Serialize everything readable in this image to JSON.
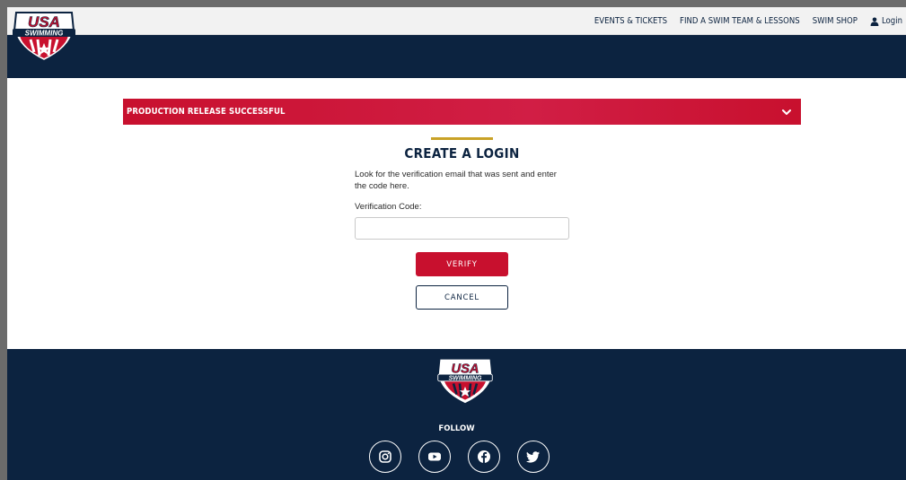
{
  "utility_nav": {
    "items": [
      {
        "label": "EVENTS & TICKETS"
      },
      {
        "label": "FIND A SWIM TEAM & LESSONS"
      },
      {
        "label": "SWIM SHOP"
      }
    ],
    "login_label": "Login",
    "login_icon": "user-icon"
  },
  "brand": {
    "logo_text_top": "USA",
    "logo_text_bottom": "SWIMMING",
    "navy": "#0c2340",
    "red": "#c8102e",
    "gold": "#c9a227"
  },
  "banner": {
    "text": "PRODUCTION RELEASE SUCCESSFUL",
    "icon": "chevron-down-icon"
  },
  "form": {
    "title": "CREATE A LOGIN",
    "description": "Look for the verification email that was sent and enter the code here.",
    "code_label": "Verification Code:",
    "code_value": "",
    "code_placeholder": "",
    "verify_label": "VERIFY",
    "cancel_label": "CANCEL"
  },
  "footer": {
    "follow_label": "FOLLOW",
    "socials": [
      "instagram-icon",
      "youtube-icon",
      "facebook-icon",
      "twitter-icon"
    ]
  }
}
